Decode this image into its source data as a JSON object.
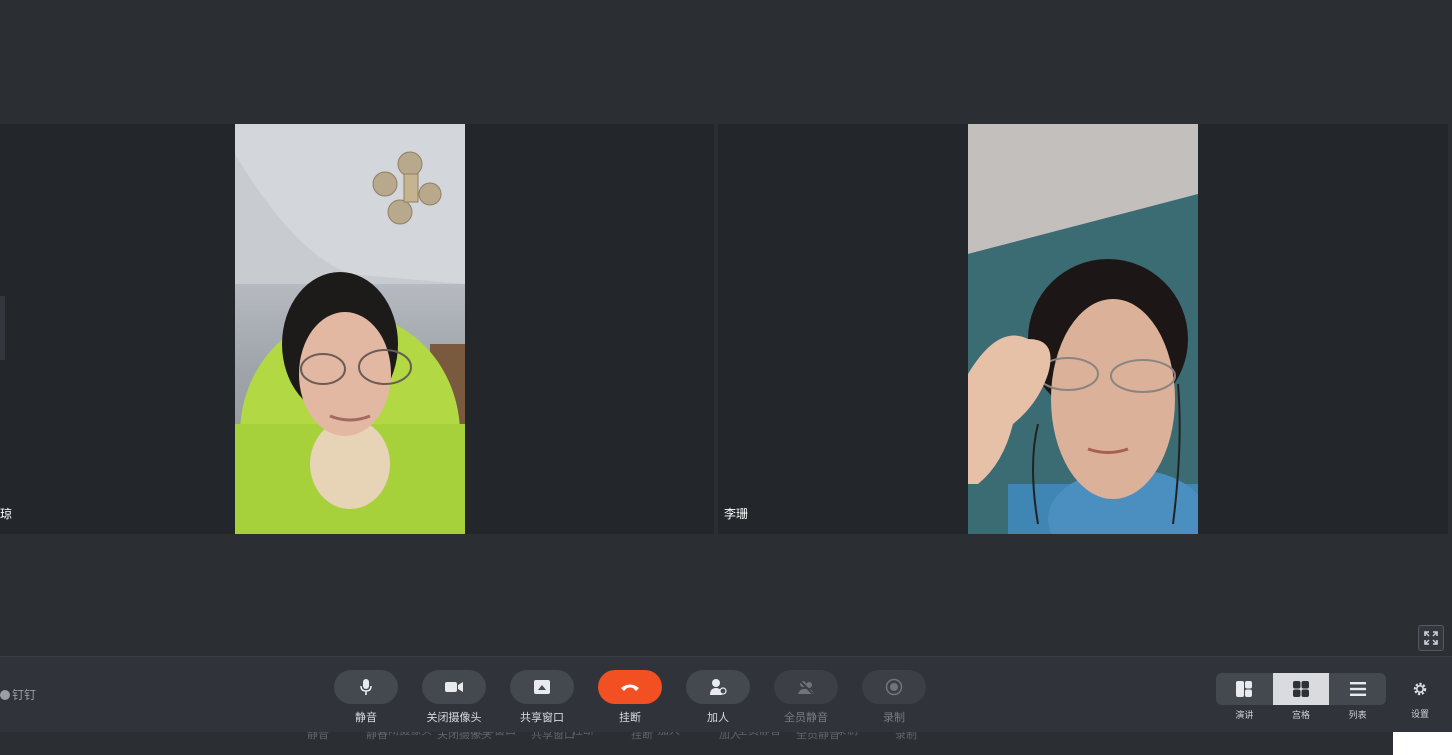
{
  "participants": [
    {
      "name": "琼"
    },
    {
      "name": "李珊"
    }
  ],
  "toolbar": {
    "pin_label": "钉钉",
    "controls": [
      {
        "label": "静音",
        "icon": "microphone-icon",
        "enabled": true
      },
      {
        "label": "关闭摄像头",
        "icon": "camera-icon",
        "enabled": true
      },
      {
        "label": "共享窗口",
        "icon": "share-window-icon",
        "enabled": true
      },
      {
        "label": "挂断",
        "icon": "hangup-icon",
        "enabled": true
      },
      {
        "label": "加人",
        "icon": "add-person-icon",
        "enabled": true
      },
      {
        "label": "全员静音",
        "icon": "mute-all-icon",
        "enabled": false
      },
      {
        "label": "录制",
        "icon": "record-icon",
        "enabled": false
      }
    ],
    "layouts": [
      {
        "label": "演讲",
        "icon": "speaker-layout-icon",
        "active": false
      },
      {
        "label": "宫格",
        "icon": "grid-layout-icon",
        "active": true
      },
      {
        "label": "列表",
        "icon": "list-layout-icon",
        "active": false
      }
    ],
    "settings_label": "设置"
  },
  "ghost_labels": [
    "静音",
    "关闭摄像头",
    "共享窗口",
    "挂断",
    "加人",
    "全员静音",
    "录制"
  ],
  "colors": {
    "hangup": "#f25022",
    "pill": "#44484f",
    "toolbar_bg": "#303339",
    "stage_bg": "#2b2e33",
    "tile_bg": "#23262b"
  }
}
